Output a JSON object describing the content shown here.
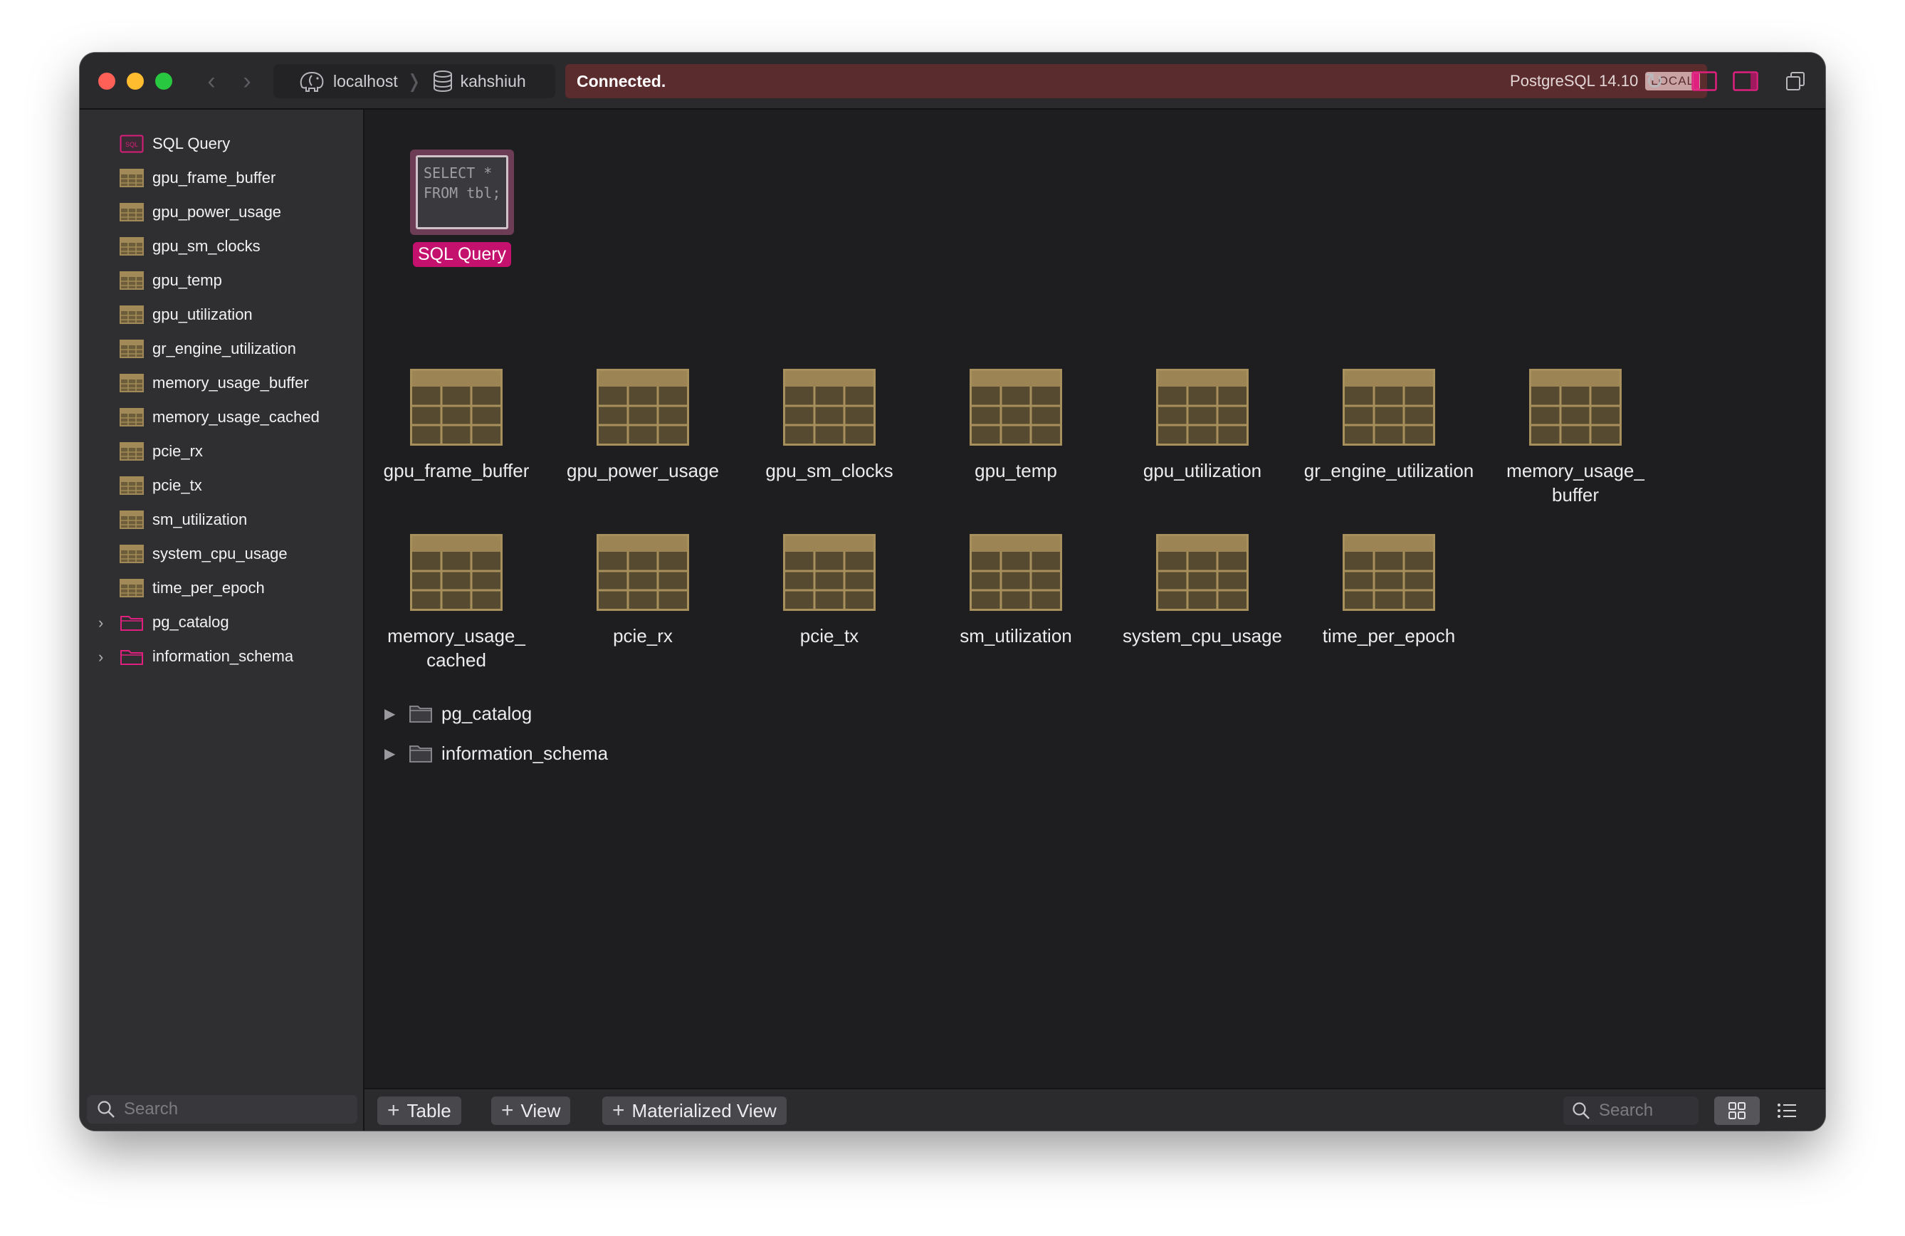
{
  "titlebar": {
    "breadcrumbs": [
      {
        "label": "localhost",
        "icon": "elephant-icon"
      },
      {
        "label": "kahshiuh",
        "icon": "database-icon"
      }
    ],
    "status": "Connected.",
    "engine": "PostgreSQL 14.10",
    "badge": "LOCAL"
  },
  "sidebar": {
    "items": [
      {
        "label": "SQL Query",
        "icon": "sql-icon"
      },
      {
        "label": "gpu_frame_buffer",
        "icon": "table-icon"
      },
      {
        "label": "gpu_power_usage",
        "icon": "table-icon"
      },
      {
        "label": "gpu_sm_clocks",
        "icon": "table-icon"
      },
      {
        "label": "gpu_temp",
        "icon": "table-icon"
      },
      {
        "label": "gpu_utilization",
        "icon": "table-icon"
      },
      {
        "label": "gr_engine_utilization",
        "icon": "table-icon"
      },
      {
        "label": "memory_usage_buffer",
        "icon": "table-icon"
      },
      {
        "label": "memory_usage_cached",
        "icon": "table-icon"
      },
      {
        "label": "pcie_rx",
        "icon": "table-icon"
      },
      {
        "label": "pcie_tx",
        "icon": "table-icon"
      },
      {
        "label": "sm_utilization",
        "icon": "table-icon"
      },
      {
        "label": "system_cpu_usage",
        "icon": "table-icon"
      },
      {
        "label": "time_per_epoch",
        "icon": "table-icon"
      },
      {
        "label": "pg_catalog",
        "icon": "folder-icon"
      },
      {
        "label": "information_schema",
        "icon": "folder-icon"
      }
    ],
    "search_placeholder": "Search"
  },
  "main": {
    "query_tile": {
      "code": "SELECT *\nFROM tbl;",
      "label": "SQL Query"
    },
    "tables": [
      "gpu_frame_buffer",
      "gpu_power_usage",
      "gpu_sm_clocks",
      "gpu_temp",
      "gpu_utilization",
      "gr_engine_utilization",
      "memory_usage_\nbuffer",
      "memory_usage_\ncached",
      "pcie_rx",
      "pcie_tx",
      "sm_utilization",
      "system_cpu_usage",
      "time_per_epoch"
    ],
    "schemas": [
      "pg_catalog",
      "information_schema"
    ]
  },
  "bottombar": {
    "add_table": "Table",
    "add_view": "View",
    "add_materialized_view": "Materialized View",
    "search_placeholder": "Search"
  },
  "colors": {
    "accent": "#c5116e",
    "status_bg": "#5b2c2e",
    "table_icon": "#8b7548"
  }
}
